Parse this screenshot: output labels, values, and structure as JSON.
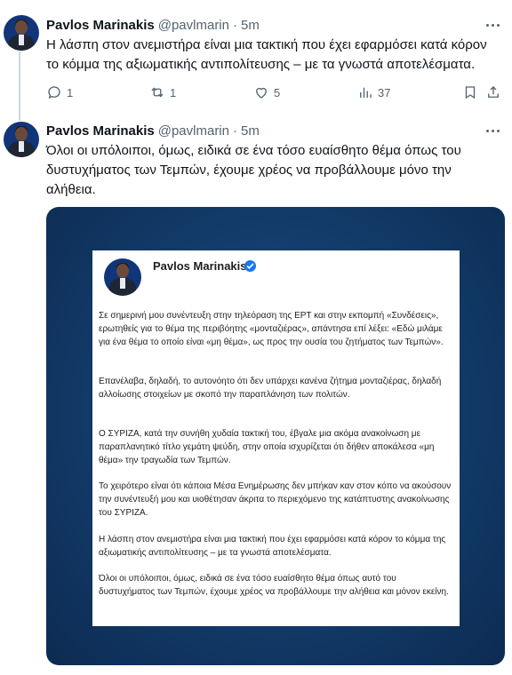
{
  "tweets": [
    {
      "author": "Pavlos Marinakis",
      "handle": "@pavlmarin",
      "separator": "·",
      "time": "5m",
      "text": "Η λάσπη στον ανεμιστήρα είναι μια τακτική που έχει εφαρμόσει κατά κόρον το κόμμα της αξιωματικής αντιπολίτευσης – με τα γνωστά αποτελέσματα.",
      "replies": "1",
      "reposts": "1",
      "likes": "5",
      "views": "37"
    },
    {
      "author": "Pavlos Marinakis",
      "handle": "@pavlmarin",
      "separator": "·",
      "time": "5m",
      "text": "Όλοι οι υπόλοιποι, όμως, ειδικά σε ένα τόσο ευαίσθητο θέμα όπως του δυστυχήματος των Τεμπών, έχουμε χρέος να προβάλλουμε μόνο την αλήθεια."
    }
  ],
  "media_card": {
    "author": "Pavlos Marinakis",
    "paragraphs": [
      "Σε σημερινή μου συνέντευξη στην τηλεόραση της ΕΡΤ και στην εκπομπή «Συνδέσεις», ερωτηθείς για το θέμα της περιβόητης «μονταζιέρας», απάντησα επί λέξει: «Εδώ μιλάμε για ένα θέμα το οποίο είναι «μη θέμα», ως προς την ουσία του ζητήματος των Τεμπών».",
      "Επανέλαβα, δηλαδή, το αυτονόητο ότι δεν υπάρχει κανένα ζήτημα μονταζιέρας, δηλαδή αλλοίωσης στοιχείων με σκοπό την παραπλάνηση των πολιτών.",
      "Ο ΣΥΡΙΖΑ, κατά την συνήθη χυδαία τακτική του, έβγαλε μια ακόμα ανακοίνωση με παραπλανητικό τίτλο γεμάτη ψεύδη, στην οποία ισχυρίζεται ότι δήθεν αποκάλεσα «μη θέμα» την τραγωδία των Τεμπών.",
      "Το χειρότερο είναι ότι κάποια Μέσα Ενημέρωσης δεν μπήκαν καν στον κόπο να ακούσουν την συνέντευξή μου και υιοθέτησαν άκριτα το περιεχόμενο της κατάπτυστης ανακοίνωσης του ΣΥΡΙΖΑ.",
      "Η λάσπη στον ανεμιστήρα είναι μια τακτική που έχει εφαρμόσει κατά κόρον το κόμμα της αξιωματικής αντιπολίτευσης – με τα γνωστά αποτελέσματα.",
      "Όλοι οι υπόλοιποι, όμως, ειδικά σε ένα τόσο ευαίσθητο θέμα όπως αυτό του δυστυχήματος των Τεμπών, έχουμε χρέος να προβάλλουμε την αλήθεια και μόνον εκείνη."
    ]
  },
  "icons": {
    "reply": "reply-icon",
    "repost": "repost-icon",
    "like": "heart-icon",
    "views": "views-icon",
    "bookmark": "bookmark-icon",
    "share": "share-icon",
    "more": "more-icon",
    "verified": "verified-badge-icon"
  },
  "colors": {
    "text": "#0f1419",
    "secondary": "#536471",
    "verified": "#1877f2",
    "media_bg": "#143e6e"
  }
}
